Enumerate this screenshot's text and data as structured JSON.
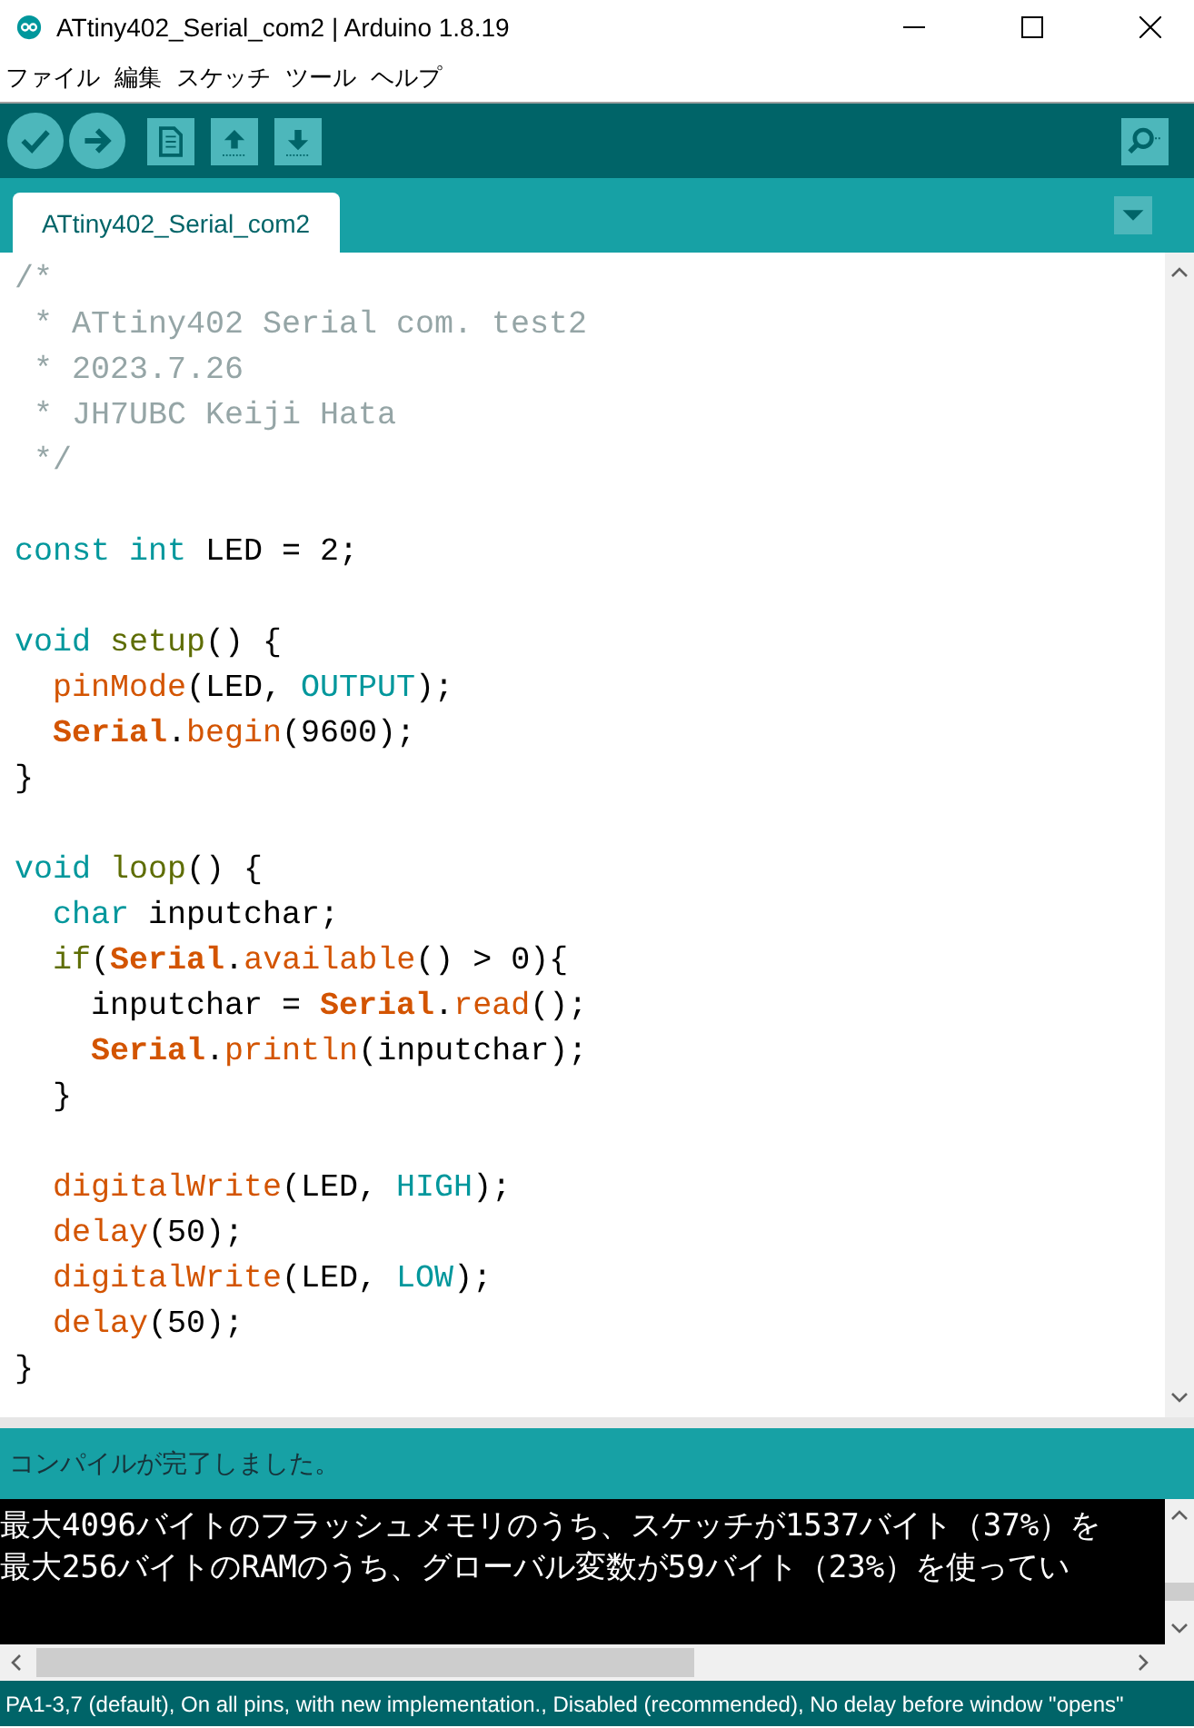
{
  "window": {
    "title": "ATtiny402_Serial_com2 | Arduino 1.8.19"
  },
  "menu": [
    {
      "label": "ファイル"
    },
    {
      "label": "編集"
    },
    {
      "label": "スケッチ"
    },
    {
      "label": "ツール"
    },
    {
      "label": "ヘルプ"
    }
  ],
  "tabs": [
    {
      "label": "ATtiny402_Serial_com2",
      "selected": true
    }
  ],
  "editor": {
    "lines": [
      {
        "tokens": [
          {
            "kind": "comment",
            "text": "/*"
          }
        ]
      },
      {
        "tokens": [
          {
            "kind": "comment",
            "text": " * ATtiny402 Serial com. test2"
          }
        ]
      },
      {
        "tokens": [
          {
            "kind": "comment",
            "text": " * 2023.7.26"
          }
        ]
      },
      {
        "tokens": [
          {
            "kind": "comment",
            "text": " * JH7UBC Keiji Hata"
          }
        ]
      },
      {
        "tokens": [
          {
            "kind": "comment",
            "text": " */"
          }
        ]
      },
      {
        "kind": "blank"
      },
      {
        "tokens": [
          {
            "kind": "keyword",
            "text": "const int"
          },
          {
            "kind": "plain",
            "text": " LED = 2;"
          }
        ]
      },
      {
        "kind": "blank"
      },
      {
        "tokens": [
          {
            "kind": "keyword",
            "text": "void"
          },
          {
            "kind": "structure",
            "text": " setup"
          },
          {
            "kind": "plain",
            "text": "() {"
          }
        ]
      },
      {
        "tokens": [
          {
            "kind": "function",
            "text": "  pinMode"
          },
          {
            "kind": "plain",
            "text": "(LED, "
          },
          {
            "kind": "keyword",
            "text": "OUTPUT"
          },
          {
            "kind": "plain",
            "text": ");"
          }
        ]
      },
      {
        "tokens": [
          {
            "kind": "class",
            "text": "  Serial"
          },
          {
            "kind": "plain",
            "text": "."
          },
          {
            "kind": "function",
            "text": "begin"
          },
          {
            "kind": "plain",
            "text": "(9600);"
          }
        ]
      },
      {
        "tokens": [
          {
            "kind": "plain",
            "text": "}"
          }
        ]
      },
      {
        "kind": "blank"
      },
      {
        "tokens": [
          {
            "kind": "keyword",
            "text": "void"
          },
          {
            "kind": "structure",
            "text": " loop"
          },
          {
            "kind": "plain",
            "text": "() {"
          }
        ]
      },
      {
        "tokens": [
          {
            "kind": "keyword",
            "text": "  char"
          },
          {
            "kind": "plain",
            "text": " inputchar;"
          }
        ]
      },
      {
        "tokens": [
          {
            "kind": "structure",
            "text": "  if"
          },
          {
            "kind": "plain",
            "text": "("
          },
          {
            "kind": "class",
            "text": "Serial"
          },
          {
            "kind": "plain",
            "text": "."
          },
          {
            "kind": "function",
            "text": "available"
          },
          {
            "kind": "plain",
            "text": "() > 0){"
          }
        ]
      },
      {
        "tokens": [
          {
            "kind": "plain",
            "text": "    inputchar = "
          },
          {
            "kind": "class",
            "text": "Serial"
          },
          {
            "kind": "plain",
            "text": "."
          },
          {
            "kind": "function",
            "text": "read"
          },
          {
            "kind": "plain",
            "text": "();"
          }
        ]
      },
      {
        "tokens": [
          {
            "kind": "class",
            "text": "    Serial"
          },
          {
            "kind": "plain",
            "text": "."
          },
          {
            "kind": "function",
            "text": "println"
          },
          {
            "kind": "plain",
            "text": "(inputchar);"
          }
        ]
      },
      {
        "tokens": [
          {
            "kind": "plain",
            "text": "  }"
          }
        ]
      },
      {
        "kind": "blank"
      },
      {
        "tokens": [
          {
            "kind": "function",
            "text": "  digitalWrite"
          },
          {
            "kind": "plain",
            "text": "(LED, "
          },
          {
            "kind": "keyword",
            "text": "HIGH"
          },
          {
            "kind": "plain",
            "text": ");"
          }
        ]
      },
      {
        "tokens": [
          {
            "kind": "function",
            "text": "  delay"
          },
          {
            "kind": "plain",
            "text": "(50);"
          }
        ]
      },
      {
        "tokens": [
          {
            "kind": "function",
            "text": "  digitalWrite"
          },
          {
            "kind": "plain",
            "text": "(LED, "
          },
          {
            "kind": "keyword",
            "text": "LOW"
          },
          {
            "kind": "plain",
            "text": ");"
          }
        ]
      },
      {
        "tokens": [
          {
            "kind": "function",
            "text": "  delay"
          },
          {
            "kind": "plain",
            "text": "(50);"
          }
        ]
      },
      {
        "tokens": [
          {
            "kind": "plain",
            "text": "}"
          }
        ]
      }
    ]
  },
  "message": "コンパイルが完了しました。",
  "console": {
    "lines": [
      "最大4096バイトのフラッシュメモリのうち、スケッチが1537バイト（37%）を",
      "最大256バイトのRAMのうち、グローバル変数が59バイト（23%）を使ってい"
    ]
  },
  "status_bar": "PA1-3,7 (default), On all pins, with new implementation., Disabled (recommended), No delay before window \"opens\""
}
